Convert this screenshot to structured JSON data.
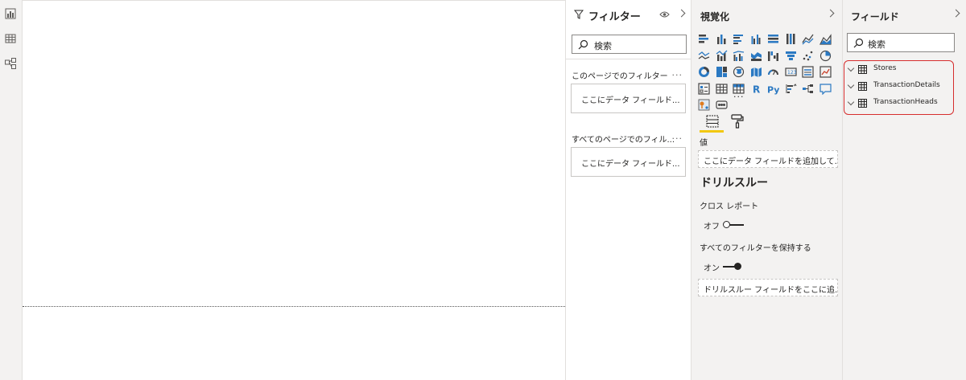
{
  "filters": {
    "title": "フィルター",
    "search_placeholder": "検索",
    "this_page_label": "このページでのフィルター",
    "this_page_well": "ここにデータ フィールド...",
    "all_pages_label": "すべてのページでのフィル...",
    "all_pages_well": "ここにデータ フィールド...",
    "more": "..."
  },
  "visualizations": {
    "title": "視覚化",
    "more_visuals": "···",
    "values_label": "値",
    "values_well": "ここにデータ フィールドを追加して...",
    "drillthrough_title": "ドリルスルー",
    "cross_report_label": "クロス レポート",
    "cross_report_state": "オフ",
    "keep_filters_label": "すべてのフィルターを保持する",
    "keep_filters_state": "オン",
    "drill_well": "ドリルスルー フィールドをここに追..."
  },
  "fields": {
    "title": "フィールド",
    "search_placeholder": "検索",
    "tables": [
      "Stores",
      "TransactionDetails",
      "TransactionHeads"
    ]
  },
  "colors": {
    "accent_yellow": "#f2c811",
    "highlight_red": "#d62e2e",
    "icon_blue": "#2b79c2",
    "pane_bg": "#f3f2f1"
  }
}
